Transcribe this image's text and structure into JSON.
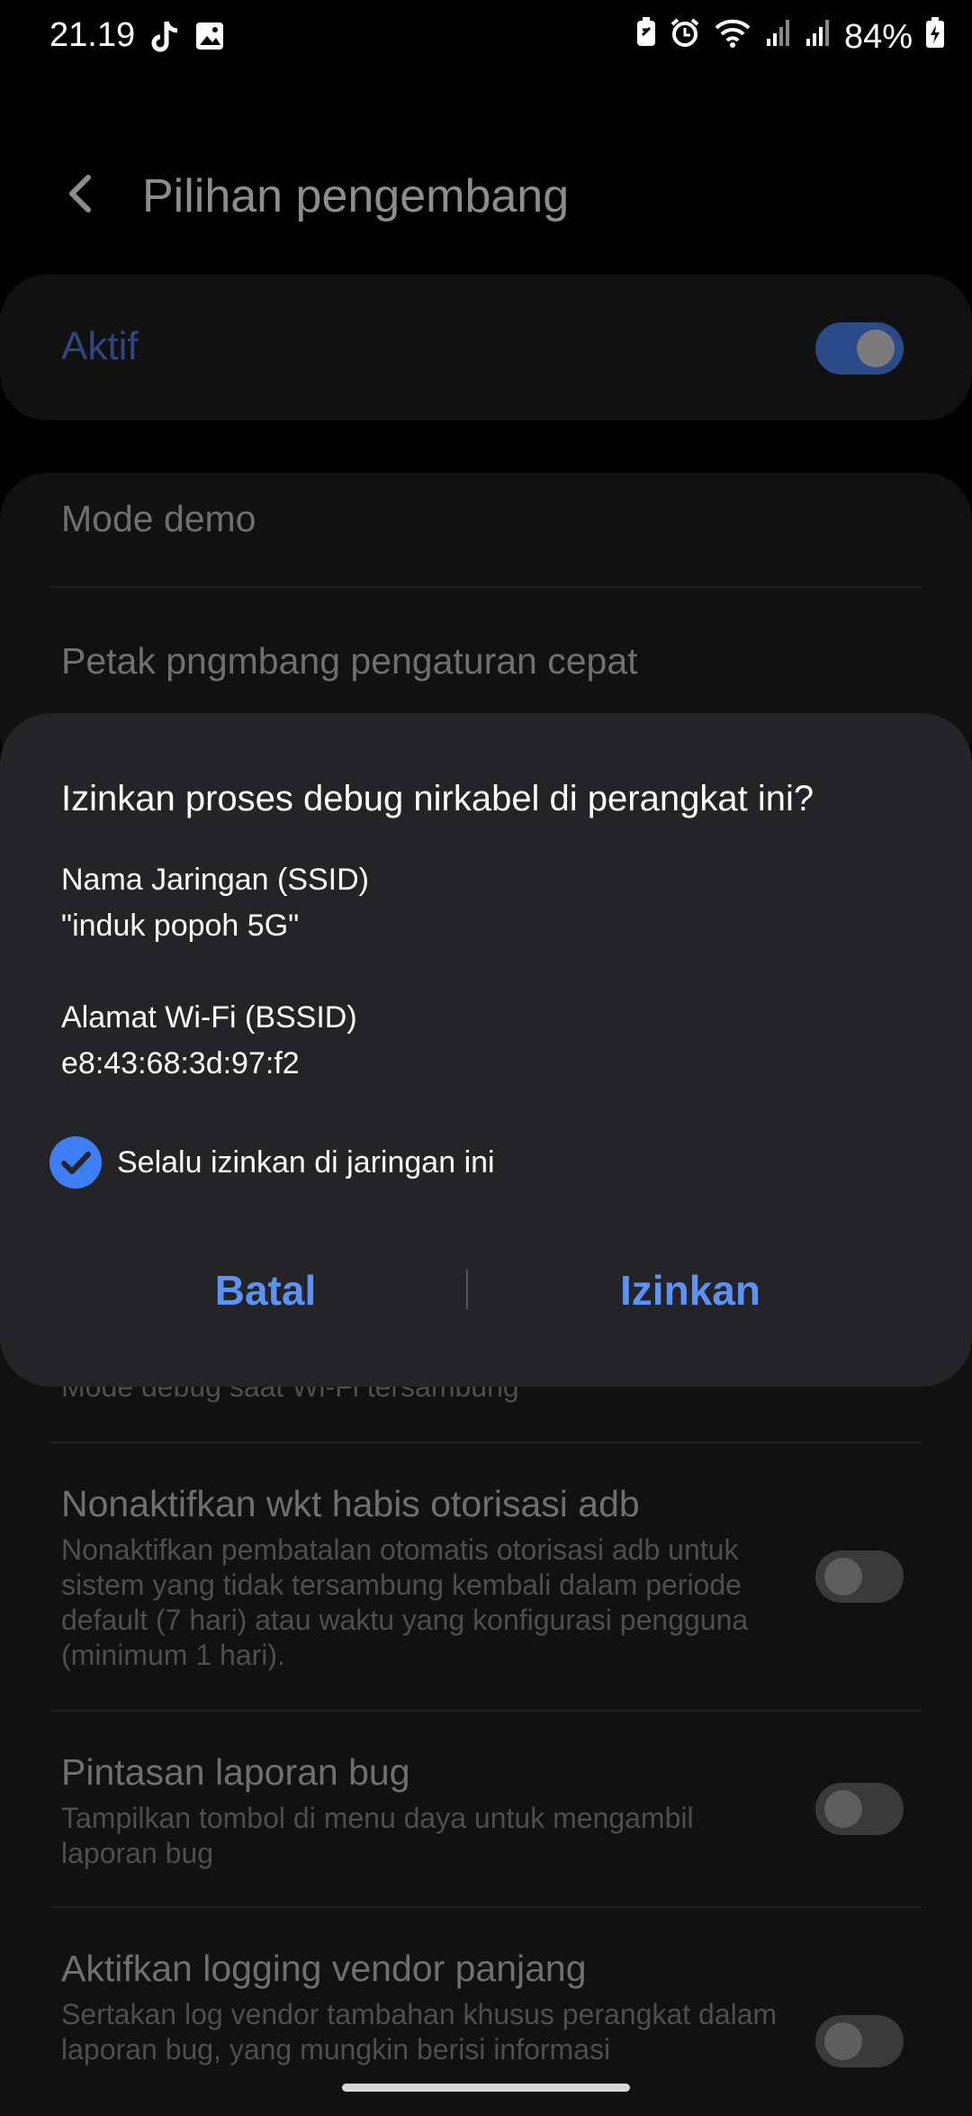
{
  "status_bar": {
    "time": "21.19",
    "battery": "84%",
    "left_icons": [
      "tiktok-icon",
      "image-icon"
    ],
    "right_icons": [
      "battery-saver-icon",
      "alarm-icon",
      "wifi-icon",
      "signal-icon",
      "signal-icon",
      "battery-charging-icon"
    ]
  },
  "header": {
    "title": "Pilihan pengembang",
    "back_icon": "chevron-left-icon"
  },
  "master_switch": {
    "label": "Aktif",
    "on": true
  },
  "settings": {
    "mode_demo": "Mode demo",
    "quick_tiles": "Petak pngmbang pengaturan cepat",
    "partial_row": "Mode debug saat Wi-Fi tersambung",
    "adb_timeout": {
      "title": "Nonaktifkan wkt habis otorisasi adb",
      "subtitle": "Nonaktifkan pembatalan otomatis otorisasi adb untuk sistem yang tidak tersambung kembali dalam periode default (7 hari) atau waktu yang konfigurasi pengguna (minimum 1 hari).",
      "on": false
    },
    "bug_report": {
      "title": "Pintasan laporan bug",
      "subtitle": "Tampilkan tombol di menu daya untuk mengambil laporan bug",
      "on": false
    },
    "vendor_logging": {
      "title": "Aktifkan logging vendor panjang",
      "subtitle": "Sertakan log vendor tambahan khusus perangkat dalam laporan bug, yang mungkin berisi informasi",
      "on": false
    }
  },
  "dialog": {
    "title": "Izinkan proses debug nirkabel di perangkat ini?",
    "ssid_label": "Nama Jaringan (SSID)",
    "ssid_value": "\"induk popoh 5G\"",
    "bssid_label": "Alamat Wi-Fi (BSSID)",
    "bssid_value": "e8:43:68:3d:97:f2",
    "checkbox_label": "Selalu izinkan di jaringan ini",
    "checkbox_checked": true,
    "cancel_label": "Batal",
    "allow_label": "Izinkan",
    "accent_color": "#3e7ef5"
  }
}
